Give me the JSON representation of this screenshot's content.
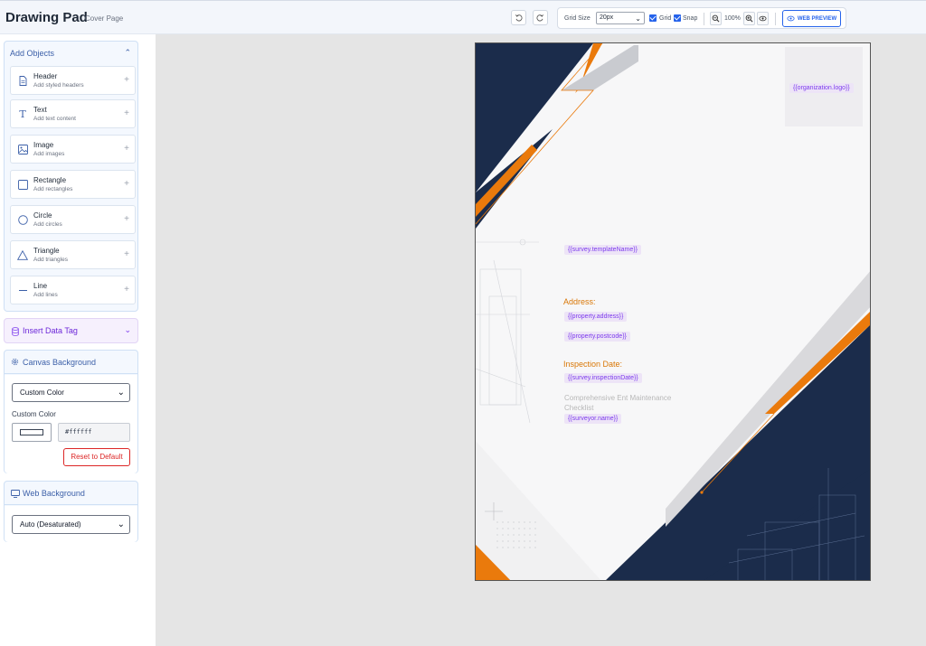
{
  "header": {
    "title": "Drawing Pad",
    "subtitle": "Cover Page",
    "undo_icon": "undo-icon",
    "redo_icon": "redo-icon",
    "grid_size_label": "Grid Size",
    "grid_size_value": "20px",
    "grid_label": "Grid",
    "snap_label": "Snap",
    "zoom_level": "100%",
    "web_preview_label": "WEB PREVIEW"
  },
  "sidebar": {
    "add_objects": {
      "title": "Add Objects",
      "items": [
        {
          "name": "Header",
          "desc": "Add styled headers",
          "icon": "document-icon"
        },
        {
          "name": "Text",
          "desc": "Add text content",
          "icon": "text-icon"
        },
        {
          "name": "Image",
          "desc": "Add images",
          "icon": "image-icon"
        },
        {
          "name": "Rectangle",
          "desc": "Add rectangles",
          "icon": "rectangle-icon"
        },
        {
          "name": "Circle",
          "desc": "Add circles",
          "icon": "circle-icon"
        },
        {
          "name": "Triangle",
          "desc": "Add triangles",
          "icon": "triangle-icon"
        },
        {
          "name": "Line",
          "desc": "Add lines",
          "icon": "line-icon"
        }
      ]
    },
    "insert_data_tag": {
      "title": "Insert Data Tag"
    },
    "canvas_background": {
      "title": "Canvas Background",
      "mode": "Custom Color",
      "custom_color_label": "Custom Color",
      "hex_value": "#ffffff",
      "reset_label": "Reset to Default"
    },
    "web_background": {
      "title": "Web Background",
      "mode": "Auto (Desaturated)"
    }
  },
  "canvas": {
    "tags": {
      "logo": "{{organization.logo}}",
      "template_name": "{{survey.templateName}}",
      "address": "{{property.address}}",
      "postcode": "{{property.postcode}}",
      "inspection_date": "{{survey.inspectionDate}}",
      "surveyor": "{{surveyor.name}}"
    },
    "labels": {
      "address": "Address:",
      "inspection_date": "Inspection Date:",
      "overlap_line1": "Comprehensive Ent Maintenance",
      "overlap_line2": "Checklist"
    }
  },
  "colors": {
    "navy": "#1b2c4b",
    "orange": "#ea7a0c",
    "accent": "#2563eb",
    "tag_bg": "#ede4f7",
    "tag_text": "#7c3aed"
  }
}
